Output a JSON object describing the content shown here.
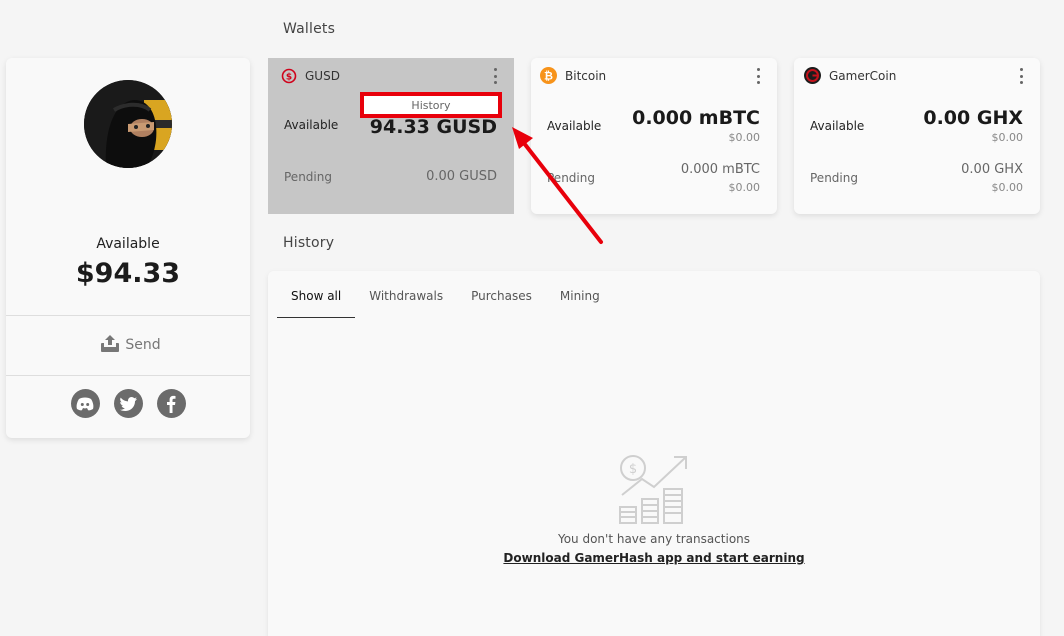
{
  "sections": {
    "wallets_title": "Wallets",
    "history_title": "History"
  },
  "profile": {
    "available_label": "Available",
    "balance": "$94.33",
    "send_label": "Send",
    "socials": [
      "discord-icon",
      "twitter-icon",
      "facebook-icon"
    ]
  },
  "wallets": [
    {
      "name": "GUSD",
      "icon": "gusd-icon",
      "color": "#d0021b",
      "available_label": "Available",
      "available_amount": "94.33 GUSD",
      "pending_label": "Pending",
      "pending_amount": "0.00 GUSD",
      "menu_item": "History"
    },
    {
      "name": "Bitcoin",
      "icon": "bitcoin-icon",
      "color": "#f7931a",
      "available_label": "Available",
      "available_amount": "0.000 mBTC",
      "available_usd": "$0.00",
      "pending_label": "Pending",
      "pending_amount": "0.000 mBTC",
      "pending_usd": "$0.00"
    },
    {
      "name": "GamerCoin",
      "icon": "gamercoin-icon",
      "color": "#c4121b",
      "available_label": "Available",
      "available_amount": "0.00 GHX",
      "available_usd": "$0.00",
      "pending_label": "Pending",
      "pending_amount": "0.00 GHX",
      "pending_usd": "$0.00"
    }
  ],
  "history": {
    "tabs": [
      "Show all",
      "Withdrawals",
      "Purchases",
      "Mining"
    ],
    "active_tab": "Show all",
    "empty_message": "You don't have any transactions",
    "empty_link": "Download GamerHash app and start earning"
  },
  "annotation_color": "#e8000b"
}
